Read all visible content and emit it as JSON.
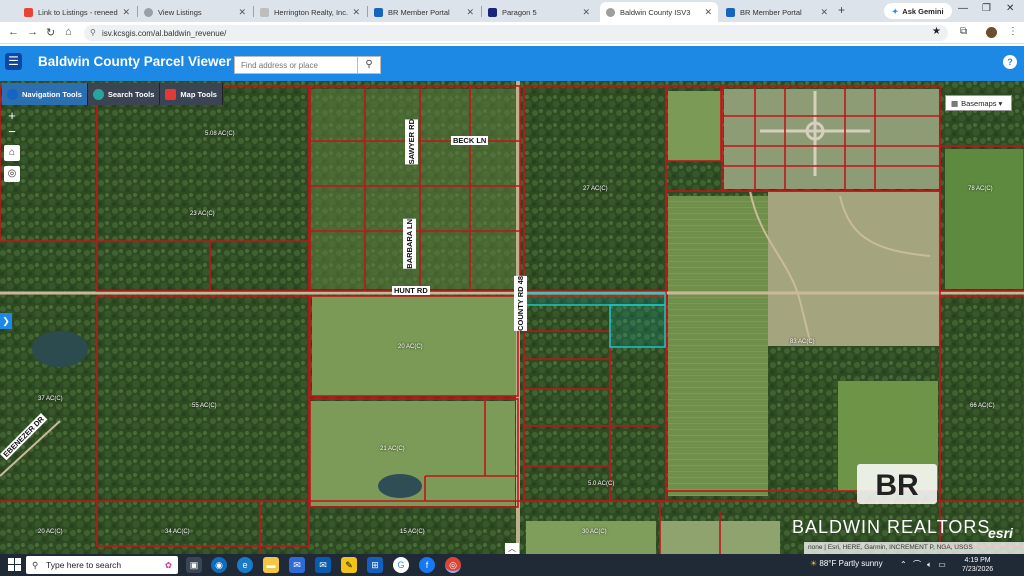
{
  "browser": {
    "tabs": [
      {
        "label": "Link to Listings - reneedore",
        "color": "#ea4335"
      },
      {
        "label": "View Listings",
        "color": "#5f6368"
      },
      {
        "label": "Herrington Realty, Inc. - Sea",
        "color": "#888888"
      },
      {
        "label": "BR Member Portal",
        "color": "#1565c0"
      },
      {
        "label": "Paragon 5",
        "color": "#1a237e"
      },
      {
        "label": "Baldwin County ISV3",
        "color": "#9e9e9e"
      },
      {
        "label": "BR Member Portal",
        "color": "#1565c0"
      }
    ],
    "new_tab": "+",
    "gemini_label": "Ask Gemini",
    "url": "isv.kcsgis.com/al.baldwin_revenue/"
  },
  "app": {
    "title": "Baldwin County Parcel Viewer",
    "search_placeholder": "Find address or place",
    "accent": "#1e88e5"
  },
  "toolbar": [
    {
      "label": "Navigation Tools",
      "icon": "globe-icon",
      "active": true
    },
    {
      "label": "Search Tools",
      "icon": "search-tools-icon",
      "active": false
    },
    {
      "label": "Map Tools",
      "icon": "map-tools-icon",
      "active": false
    }
  ],
  "map": {
    "basemaps_label": "Basemaps",
    "roads": [
      "BECK LN",
      "SAWYER RD",
      "BARBARA LN",
      "HUNT RD",
      "COUNTY RD 48",
      "EBENEZER DR"
    ],
    "acre_labels": [
      "5.08 AC(C)",
      "27 AC(C)",
      "78 AC(C)",
      "23 AC(C)",
      "20 AC(C)",
      "83 AC(C)",
      "37 AC(C)",
      "55 AC(C)",
      "66 AC(C)",
      "21 AC(C)",
      "20 AC(C)",
      "34 AC(C)",
      "5.0 AC(C)",
      "15 AC(C)",
      "30 AC(C)"
    ],
    "attribution": "none | Esri, HERE, Garmin, INCREMENT P, NGA, USGS",
    "watermark_brand": "BALDWIN REALTORS",
    "watermark_mark": "BR",
    "esri": "esri"
  },
  "taskbar": {
    "search_placeholder": "Type here to search",
    "weather": "88°F  Partly sunny",
    "time": "4:19 PM",
    "date": "7/23/2026"
  }
}
